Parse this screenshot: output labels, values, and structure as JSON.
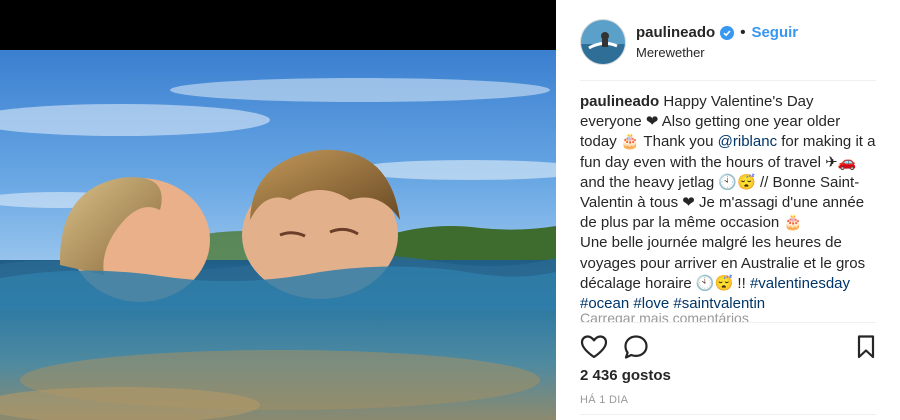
{
  "post": {
    "username": "paulineado",
    "follow_label": "Seguir",
    "location": "Merewether",
    "caption": {
      "lines": [
        "Happy Valentine's Day",
        "everyone ❤ Also getting one year older",
        "today 🎂 Thank you ",
        "fun day even with the hours of travel ✈🚗",
        "and the heavy jetlag 🕙😴 // Bonne Saint-",
        "Valentin à tous ❤ Je m'assagi d'une année",
        "de plus par la même occasion 🎂",
        "Une belle journée malgré les heures de",
        "voyages pour arriver en Australie et le gros",
        "décalage horaire 🕙😴 !! "
      ],
      "mention": "@riblanc",
      "after_mention": " for making it a",
      "tags": [
        "#valentinesday",
        "#ocean",
        "#love",
        "#saintvalentin"
      ]
    },
    "load_more": "Carregar mais comentários",
    "likes": "2 436 gostos",
    "time": "HÁ 1 DIA"
  },
  "icons": {
    "verified": "verified-badge-icon",
    "like": "heart-icon",
    "comment": "comment-bubble-icon",
    "save": "bookmark-icon"
  },
  "colors": {
    "link": "#3897f0",
    "hashtag": "#003569",
    "muted": "#999999",
    "text": "#262626"
  }
}
